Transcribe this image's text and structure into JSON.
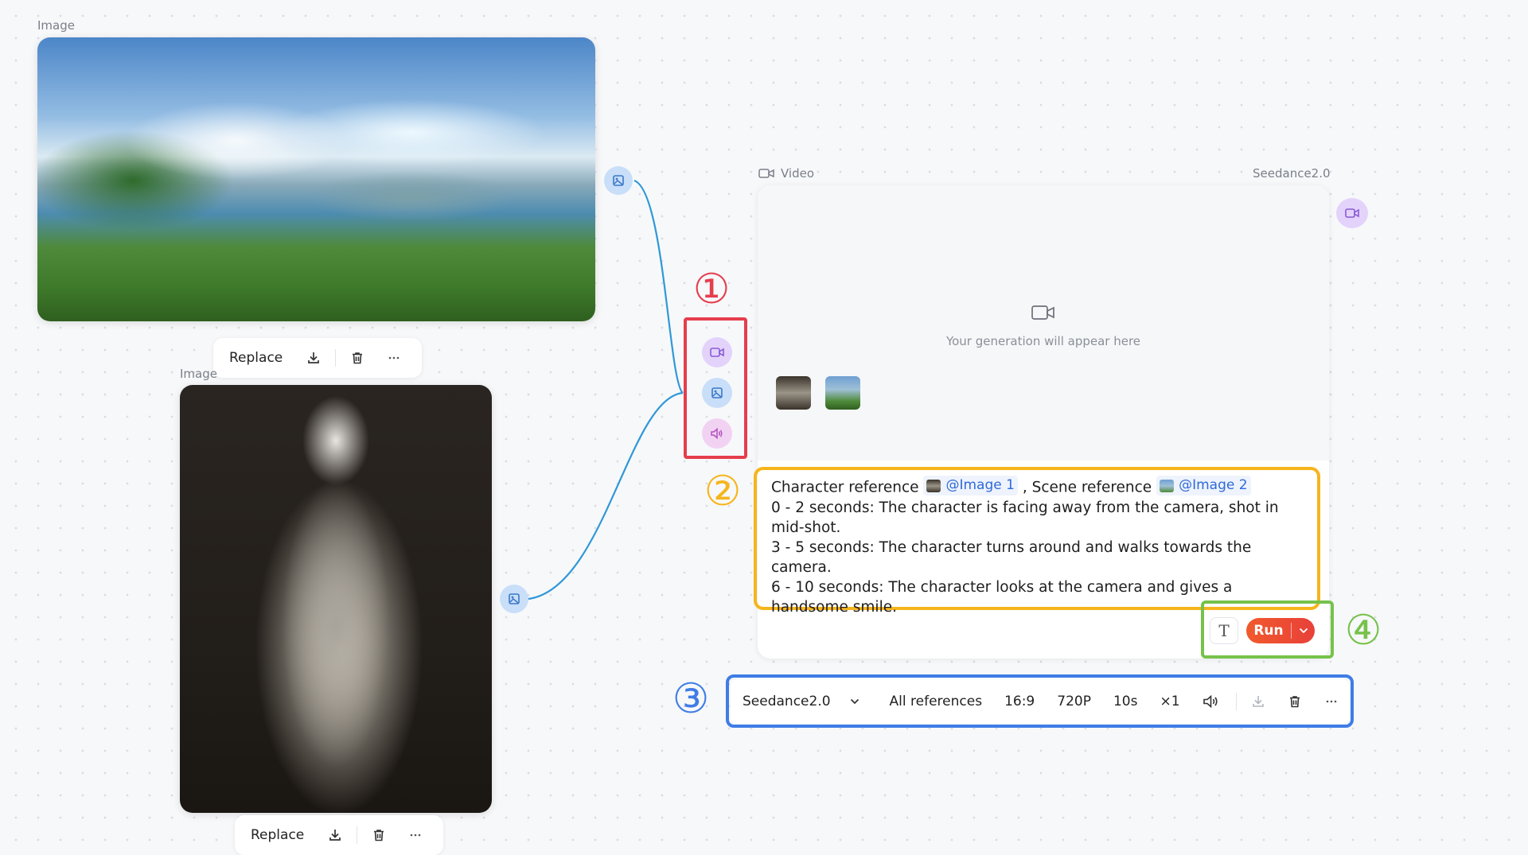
{
  "nodes": {
    "image1": {
      "label": "Image"
    },
    "image2": {
      "label": "Image"
    }
  },
  "image_toolbar": {
    "replace_label": "Replace"
  },
  "video_node": {
    "label": "Video",
    "model_label": "Seedance2.0",
    "placeholder": "Your generation will appear here"
  },
  "prompt": {
    "part1": "Character reference",
    "ref1": "@Image 1",
    "part2": ", Scene reference",
    "ref2": "@Image 2",
    "line1": "0 - 2 seconds: The character is facing away from the camera, shot in mid-shot.",
    "line2": "3 - 5 seconds: The character turns around and walks towards the camera.",
    "line3": "6 - 10 seconds: The character looks at the camera and gives a handsome smile."
  },
  "run": {
    "label": "Run",
    "text_tool": "T"
  },
  "settings": {
    "model": "Seedance2.0",
    "references": "All references",
    "ratio": "16:9",
    "resolution": "720P",
    "duration": "10s",
    "count": "×1"
  },
  "annotations": {
    "n1": "①",
    "n2": "②",
    "n3": "③",
    "n4": "④"
  },
  "colors": {
    "red": "#e53e4d",
    "yellow": "#f6b51c",
    "blue": "#3f7de6",
    "green": "#76c24a",
    "run": "#f15a2c",
    "link": "#2f6ad8",
    "connector": "#2f98d8"
  }
}
